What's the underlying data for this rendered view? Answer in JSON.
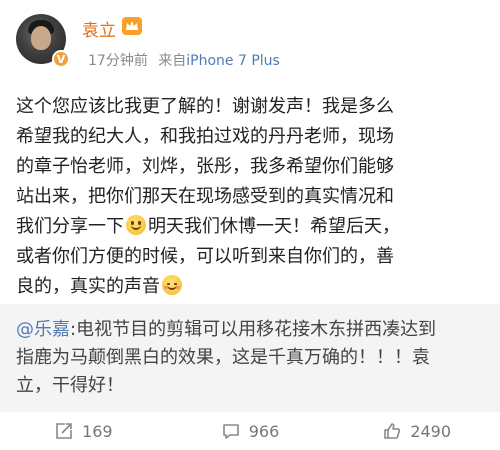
{
  "user": {
    "name": "袁立",
    "time": "17分钟前",
    "source_label": "来自",
    "device": "iPhone 7 Plus",
    "verified_badge": "V"
  },
  "post": {
    "lines": [
      "这个您应该比我更了解的！谢谢发声！我是多么",
      "希望我的纪大人，和我拍过戏的丹丹老师，现场",
      "的章子怡老师，刘烨，张彤，我多希望你们能够",
      "站出来，把你们那天在现场感受到的真实情况和"
    ],
    "line5_before_emoji": "我们分享一下",
    "line5_after_emoji": "明天我们休博一天！希望后天，",
    "line6": "或者你们方便的时候，可以听到来自你们的，善",
    "line7": "良的，真实的声音"
  },
  "quote": {
    "mention": "@乐嘉",
    "line1_rest": ":电视节目的剪辑可以用移花接木东拼西凑达到",
    "line2": "指鹿为马颠倒黑白的效果，这是千真万确的！！！袁",
    "line3": "立，干得好！"
  },
  "actions": {
    "repost_count": "169",
    "comment_count": "966",
    "like_count": "2490"
  },
  "colors": {
    "username": "#e86b0c",
    "link": "#4f7bb5",
    "quote_bg": "#f4f4f4",
    "meta": "#8a8a8a"
  },
  "icons": [
    "vip-crown-icon",
    "verified-badge-icon",
    "smile-emoji-icon",
    "shy-emoji-icon",
    "repost-icon",
    "comment-icon",
    "like-icon"
  ]
}
